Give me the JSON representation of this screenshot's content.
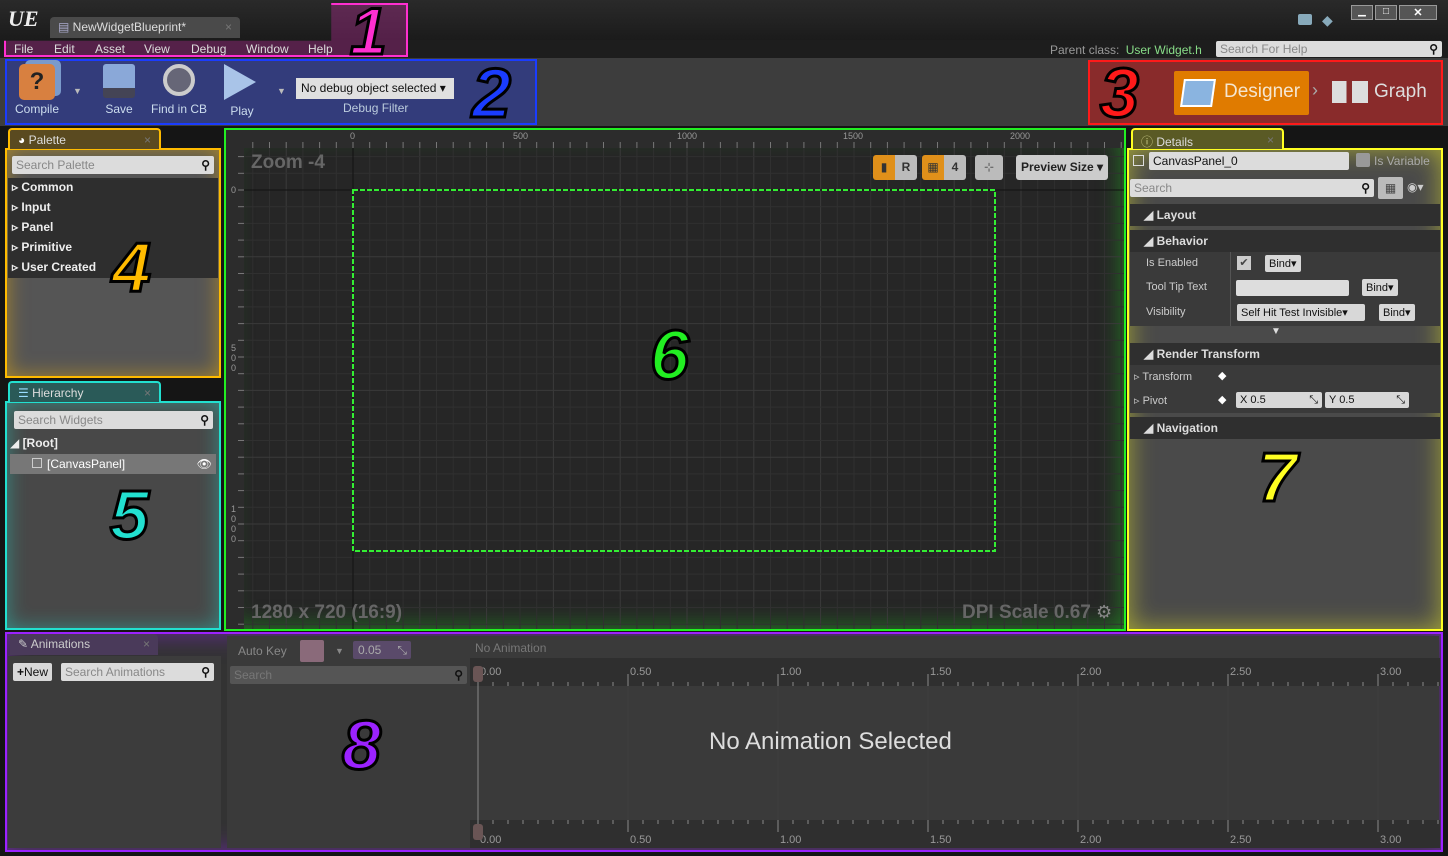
{
  "titlebar": {
    "logo": "UE",
    "tab_label": "NewWidgetBlueprint*",
    "window_buttons": [
      "minimize",
      "maximize",
      "close"
    ]
  },
  "menu": {
    "items": [
      "File",
      "Edit",
      "Asset",
      "View",
      "Debug",
      "Window",
      "Help"
    ],
    "parent_class_label": "Parent class:",
    "parent_class_value": "User Widget.h",
    "help_search_placeholder": "Search For Help"
  },
  "toolbar": {
    "compile": "Compile",
    "save": "Save",
    "find": "Find in CB",
    "play": "Play",
    "debug_select": "No debug object selected",
    "debug_filter": "Debug Filter"
  },
  "modes": {
    "designer": "Designer",
    "graph": "Graph",
    "accent": "#e07b00"
  },
  "palette": {
    "title": "Palette",
    "search_placeholder": "Search Palette",
    "categories": [
      "Common",
      "Input",
      "Panel",
      "Primitive",
      "User Created"
    ]
  },
  "hierarchy": {
    "title": "Hierarchy",
    "search_placeholder": "Search Widgets",
    "root": "[Root]",
    "child": "[CanvasPanel]"
  },
  "canvas": {
    "zoom": "Zoom -4",
    "ruler_top": [
      "0",
      "500",
      "1000",
      "1500",
      "2000"
    ],
    "ruler_left": [
      "0",
      "500",
      "1000"
    ],
    "r_button": "R",
    "grid_size": "4",
    "preview_size": "Preview Size",
    "resolution": "1280 x 720 (16:9)",
    "dpi": "DPI Scale 0.67"
  },
  "details": {
    "title": "Details",
    "name_value": "CanvasPanel_0",
    "is_variable": "Is Variable",
    "search_placeholder": "Search",
    "sections": {
      "layout": "Layout",
      "behavior": "Behavior",
      "render_transform": "Render Transform",
      "navigation": "Navigation"
    },
    "is_enabled": "Is Enabled",
    "tool_tip": "Tool Tip Text",
    "visibility": "Visibility",
    "visibility_value": "Self Hit Test Invisible",
    "bind": "Bind",
    "transform": "Transform",
    "pivot": "Pivot",
    "pivot_x": "X  0.5",
    "pivot_y": "Y  0.5"
  },
  "animations": {
    "title": "Animations",
    "new_button": "New",
    "search_placeholder": "Search Animations",
    "auto_key": "Auto Key",
    "snap_value": "0.05",
    "no_animation": "No Animation",
    "timeline_search": "Search",
    "ticks": [
      "0.00",
      "0.50",
      "1.00",
      "1.50",
      "2.00",
      "2.50",
      "3.00"
    ],
    "empty_message": "No Animation Selected"
  },
  "annotations": {
    "colors": {
      "1": "#ff2fd0",
      "2": "#1a3cff",
      "3": "#ff1a1a",
      "4": "#ffbb00",
      "5": "#22e0d0",
      "6": "#22ee22",
      "7": "#ffff22",
      "8": "#9b22ff"
    },
    "labels": [
      "1",
      "2",
      "3",
      "4",
      "5",
      "6",
      "7",
      "8"
    ]
  }
}
